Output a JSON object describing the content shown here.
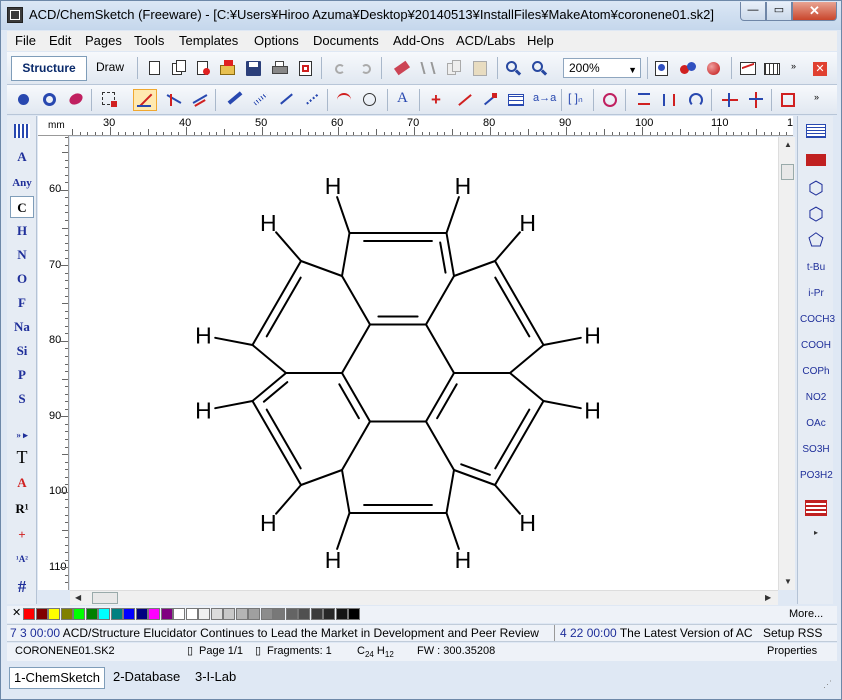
{
  "window": {
    "title": "ACD/ChemSketch (Freeware) - [C:¥Users¥Hiroo Azuma¥Desktop¥20140513¥InstallFiles¥MakeAtom¥coronene01.sk2]"
  },
  "menu": {
    "items": [
      "File",
      "Edit",
      "Pages",
      "Tools",
      "Templates",
      "Options",
      "Documents",
      "Add-Ons",
      "ACD/Labs",
      "Help"
    ]
  },
  "toolbar": {
    "structure_label": "Structure",
    "draw_label": "Draw",
    "zoom_value": "200%"
  },
  "left_palette": {
    "items": [
      "A",
      "Any",
      "C",
      "H",
      "N",
      "O",
      "F",
      "Na",
      "Si",
      "P",
      "S",
      "T",
      "R¹",
      "+",
      "#"
    ],
    "selected": "C"
  },
  "right_palette": {
    "groups": [
      "t-Bu",
      "i-Pr",
      "COCH3",
      "COOH",
      "COPh",
      "NO2",
      "OAc",
      "SO3H",
      "PO3H2"
    ]
  },
  "ruler": {
    "unit": "mm",
    "h_labels": [
      "30",
      "40",
      "50",
      "60",
      "70",
      "80",
      "90",
      "100",
      "110",
      "12"
    ],
    "v_labels": [
      "60",
      "70",
      "80",
      "90",
      "100",
      "110"
    ]
  },
  "molecule": {
    "atom_label": "H",
    "name": "coronene"
  },
  "colorbar": {
    "colors": [
      "#ff0000",
      "#800000",
      "#ffff00",
      "#808000",
      "#00ff00",
      "#008000",
      "#00ffff",
      "#008080",
      "#0000ff",
      "#000080",
      "#ff00ff",
      "#800080",
      "#ffffff",
      "#ffffff",
      "#f0f0f0",
      "#dcdcdc",
      "#c8c8c8",
      "#b4b4b4",
      "#a0a0a0",
      "#8c8c8c",
      "#787878",
      "#646464",
      "#505050",
      "#3c3c3c",
      "#282828",
      "#141414",
      "#000000"
    ],
    "more_label": "More..."
  },
  "ticker": {
    "news1_time": "7 3 00:00",
    "news1_text": "ACD/Structure Elucidator Continues to Lead the Market in Development and Peer Review",
    "news2_time": "4 22 00:00",
    "news2_text": "The Latest Version of AC",
    "setup_label": "Setup RSS"
  },
  "status": {
    "file": "CORONENE01.SK2",
    "page": "Page 1/1",
    "fragments": "Fragments: 1",
    "formula_c": "C",
    "formula_c_n": "24",
    "formula_h": "H",
    "formula_h_n": "12",
    "fw": "FW : 300.35208",
    "properties": "Properties"
  },
  "bottom_tabs": {
    "tab1": "1-ChemSketch",
    "tab2": "2-Database",
    "tab3": "3-I-Lab"
  }
}
